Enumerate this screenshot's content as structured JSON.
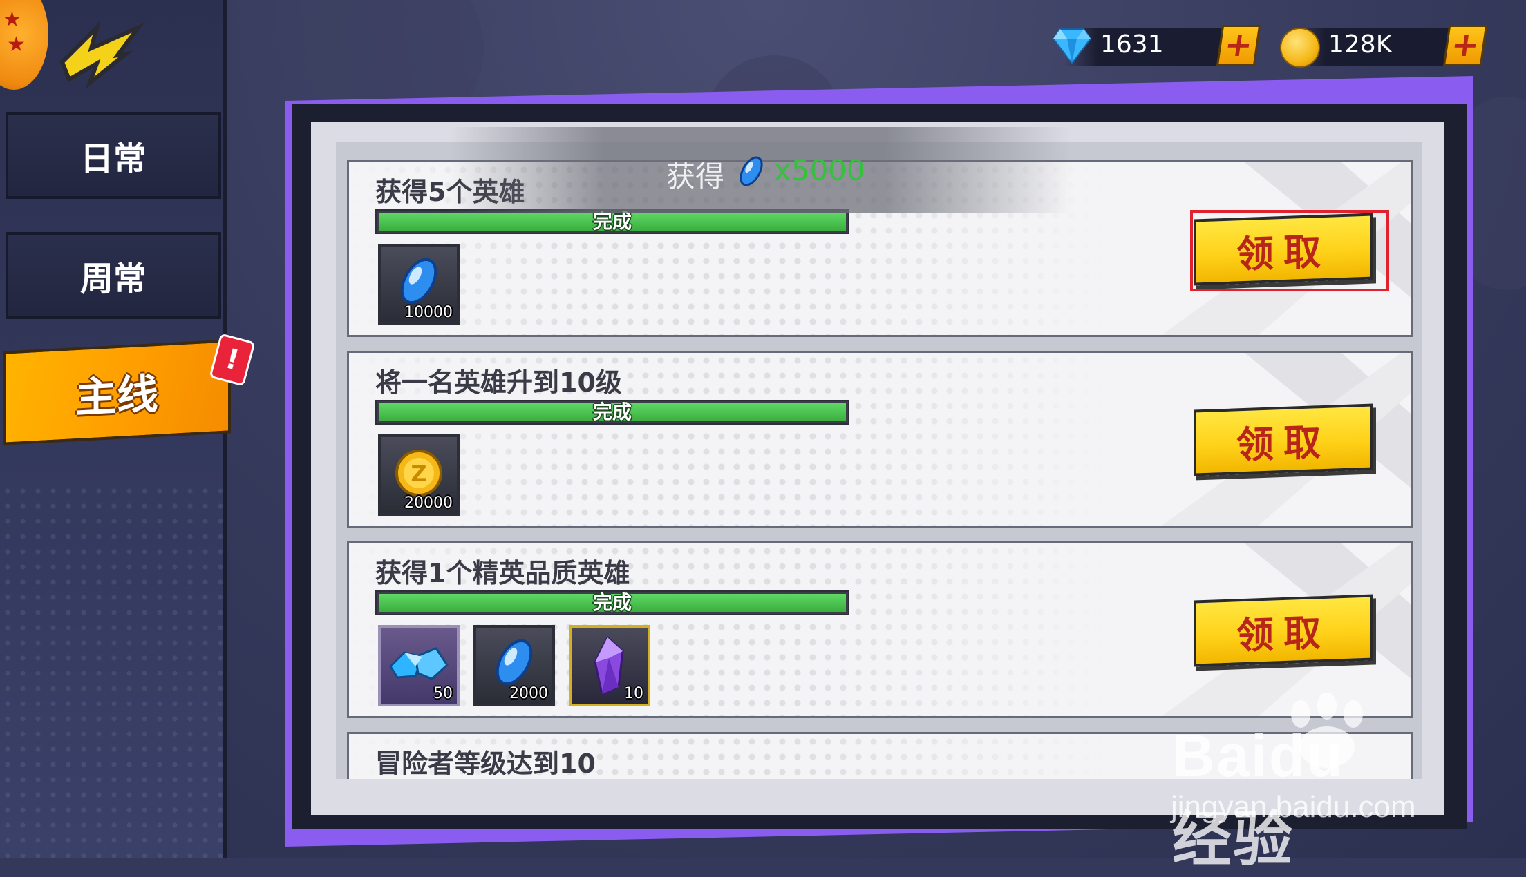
{
  "currency": {
    "gems": "1631",
    "gold": "128K",
    "plus_symbol": "+"
  },
  "sidebar": {
    "tabs": [
      {
        "label": "日常",
        "active": false
      },
      {
        "label": "周常",
        "active": false
      },
      {
        "label": "主线",
        "active": true
      }
    ],
    "alert_badge": "!"
  },
  "toast": {
    "label": "获得",
    "value": "x5000",
    "icon": "blue-capsule-icon"
  },
  "tasks": [
    {
      "title": "获得5个英雄",
      "progress_text": "完成",
      "progress": 1.0,
      "rewards": [
        {
          "icon": "blue-capsule-icon",
          "count": "10000"
        }
      ],
      "button": "领取"
    },
    {
      "title": "将一名英雄升到10级",
      "progress_text": "完成",
      "progress": 1.0,
      "rewards": [
        {
          "icon": "gold-coin-icon",
          "count": "20000"
        }
      ],
      "button": "领取"
    },
    {
      "title": "获得1个精英品质英雄",
      "progress_text": "完成",
      "progress": 1.0,
      "rewards": [
        {
          "icon": "blue-crystal-icon",
          "count": "50"
        },
        {
          "icon": "blue-capsule-icon",
          "count": "2000"
        },
        {
          "icon": "purple-crystal-icon",
          "count": "10"
        }
      ],
      "button": "领取"
    },
    {
      "title": "冒险者等级达到10"
    }
  ],
  "watermark": {
    "brand": "Baidu经验",
    "url": "jingyan.baidu.com"
  },
  "colors": {
    "accent_frame": "#8a5cf0",
    "claim_button": "#ffd21a",
    "claim_text": "#b8261a",
    "progress_fill": "#3aae3f",
    "highlight_box": "#e0222e"
  }
}
